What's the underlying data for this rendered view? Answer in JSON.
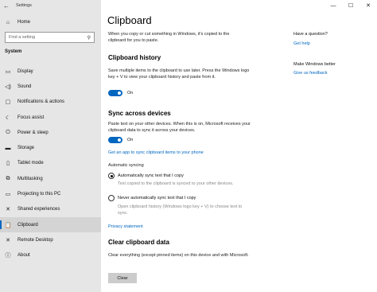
{
  "window": {
    "title": "Settings"
  },
  "nav": {
    "home": "Home",
    "search_placeholder": "Find a setting",
    "section": "System",
    "items": [
      {
        "label": "Display",
        "icon": "display-icon",
        "glyph": "▭"
      },
      {
        "label": "Sound",
        "icon": "sound-icon",
        "glyph": "◁)"
      },
      {
        "label": "Notifications & actions",
        "icon": "notifications-icon",
        "glyph": "▢"
      },
      {
        "label": "Focus assist",
        "icon": "focus-assist-icon",
        "glyph": "☾"
      },
      {
        "label": "Power & sleep",
        "icon": "power-icon",
        "glyph": "⏻"
      },
      {
        "label": "Storage",
        "icon": "storage-icon",
        "glyph": "▬"
      },
      {
        "label": "Tablet mode",
        "icon": "tablet-icon",
        "glyph": "▯"
      },
      {
        "label": "Multitasking",
        "icon": "multitasking-icon",
        "glyph": "⧉"
      },
      {
        "label": "Projecting to this PC",
        "icon": "projecting-icon",
        "glyph": "▭"
      },
      {
        "label": "Shared experiences",
        "icon": "shared-icon",
        "glyph": "✕"
      },
      {
        "label": "Clipboard",
        "icon": "clipboard-icon",
        "glyph": "📋",
        "selected": true
      },
      {
        "label": "Remote Desktop",
        "icon": "remote-desktop-icon",
        "glyph": "✕"
      },
      {
        "label": "About",
        "icon": "info-icon",
        "glyph": "ⓘ"
      }
    ]
  },
  "main": {
    "title": "Clipboard",
    "intro": "When you copy or cut something in Windows, it's copied to the clipboard for you to paste.",
    "history": {
      "heading": "Clipboard history",
      "desc": "Save multiple items to the clipboard to use later. Press the Windows logo key + V to view your clipboard history and paste from it.",
      "toggle_label": "On"
    },
    "sync": {
      "heading": "Sync across devices",
      "desc": "Paste text on your other devices. When this is on, Microsoft receives your clipboard data to sync it across your devices.",
      "toggle_label": "On",
      "app_link": "Get an app to sync clipboard items to your phone",
      "auto_label": "Automatic syncing",
      "option1": "Automatically sync text that I copy",
      "option1_desc": "Text copied to the clipboard is synced to your other devices.",
      "option2": "Never automatically sync text that I copy",
      "option2_desc": "Open clipboard history (Windows logo key + V) to choose text to sync."
    },
    "privacy_link": "Privacy statement",
    "clear": {
      "heading": "Clear clipboard data",
      "desc": "Clear everything (except pinned items) on this device and with Microsoft.",
      "button": "Clear"
    }
  },
  "side": {
    "question": "Have a question?",
    "get_help": "Get help",
    "better": "Make Windows better",
    "feedback": "Give us feedback"
  },
  "colors": {
    "accent": "#0067c0",
    "nav_bg": "#e6e6e6"
  }
}
